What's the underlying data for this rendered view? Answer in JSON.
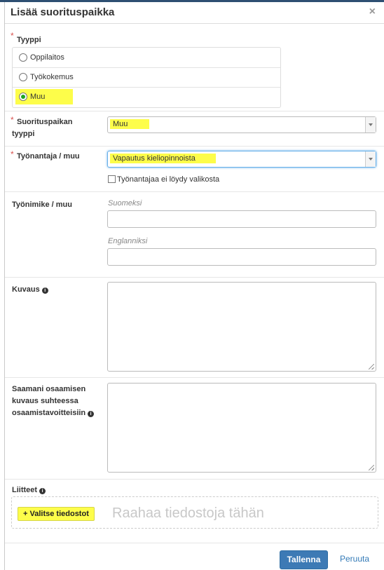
{
  "dialog": {
    "title": "Lisää suorituspaikka",
    "close_glyph": "×"
  },
  "type_field": {
    "label": "Tyyppi",
    "required_mark": "*",
    "options": [
      {
        "label": "Oppilaitos",
        "checked": false
      },
      {
        "label": "Työkokemus",
        "checked": false
      },
      {
        "label": "Muu",
        "checked": true
      }
    ]
  },
  "place_type": {
    "label_line1": "Suorituspaikan",
    "label_line2": "tyyppi",
    "required_mark": "*",
    "value": "Muu"
  },
  "employer": {
    "label": "Työnantaja / muu",
    "required_mark": "*",
    "value": "Vapautus kieliopinnoista",
    "not_found_label": "Työnantajaa ei löydy valikosta",
    "not_found_checked": false
  },
  "job_title": {
    "label": "Työnimike / muu",
    "finnish_hint": "Suomeksi",
    "english_hint": "Englanniksi",
    "finnish_value": "",
    "english_value": ""
  },
  "description": {
    "label": "Kuvaus",
    "info_glyph": "i",
    "value": ""
  },
  "competence": {
    "label_line1": "Saamani osaamisen",
    "label_line2": "kuvaus suhteessa",
    "label_line3": "osaamistavoitteisiin",
    "info_glyph": "i",
    "value": ""
  },
  "attachments": {
    "label": "Liitteet",
    "info_glyph": "i",
    "choose_files_label": "Valitse tiedostot",
    "plus_glyph": "+",
    "drop_text": "Raahaa tiedostoja tähän"
  },
  "footer": {
    "save_label": "Tallenna",
    "cancel_label": "Peruuta"
  },
  "colors": {
    "highlight": "#fdfd4a",
    "primary": "#3d7ab5",
    "link": "#337ab7",
    "required": "#d9534f",
    "radio_checked": "#1fa51f"
  }
}
